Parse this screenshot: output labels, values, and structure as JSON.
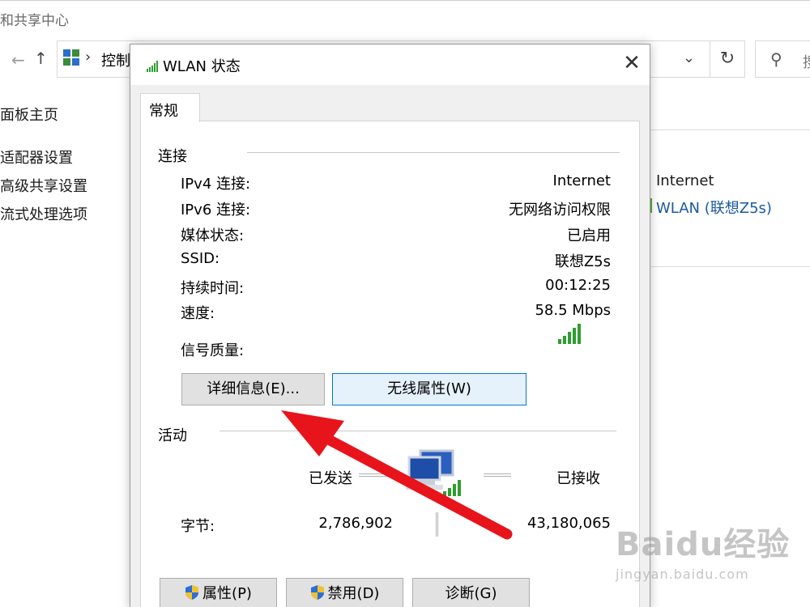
{
  "background": {
    "window_title": "和共享中心",
    "address_path": "控制",
    "search_placeholder": "搜",
    "left_links": [
      "面板主页",
      "适配器设置",
      "高级共享设置",
      "流式处理选项"
    ],
    "right_panel": {
      "access_type": "Internet",
      "connection": "WLAN (联想Z5s)"
    }
  },
  "dialog": {
    "title": "WLAN 状态",
    "tab": "常规",
    "connection_section": "连接",
    "rows": [
      {
        "label": "IPv4 连接:",
        "value": "Internet"
      },
      {
        "label": "IPv6 连接:",
        "value": "无网络访问权限"
      },
      {
        "label": "媒体状态:",
        "value": "已启用"
      },
      {
        "label": "SSID:",
        "value": "联想Z5s"
      },
      {
        "label": "持续时间:",
        "value": "00:12:25"
      },
      {
        "label": "速度:",
        "value": "58.5 Mbps"
      }
    ],
    "signal_label": "信号质量:",
    "signal_bars": 5,
    "details_button": "详细信息(E)...",
    "wireless_button": "无线属性(W)",
    "activity_section": "活动",
    "sent_label": "已发送",
    "received_label": "已接收",
    "bytes_label": "字节:",
    "bytes_sent": "2,786,902",
    "bytes_received": "43,180,065",
    "properties_button": "属性(P)",
    "disable_button": "禁用(D)",
    "diagnose_button": "诊断(G)"
  },
  "watermark": {
    "logo": "Baidu经验",
    "url": "jingyan.baidu.com"
  },
  "colors": {
    "accent_blue": "#0078d7",
    "signal_green": "#2e9e2e",
    "annotation_red": "#e8141b"
  }
}
